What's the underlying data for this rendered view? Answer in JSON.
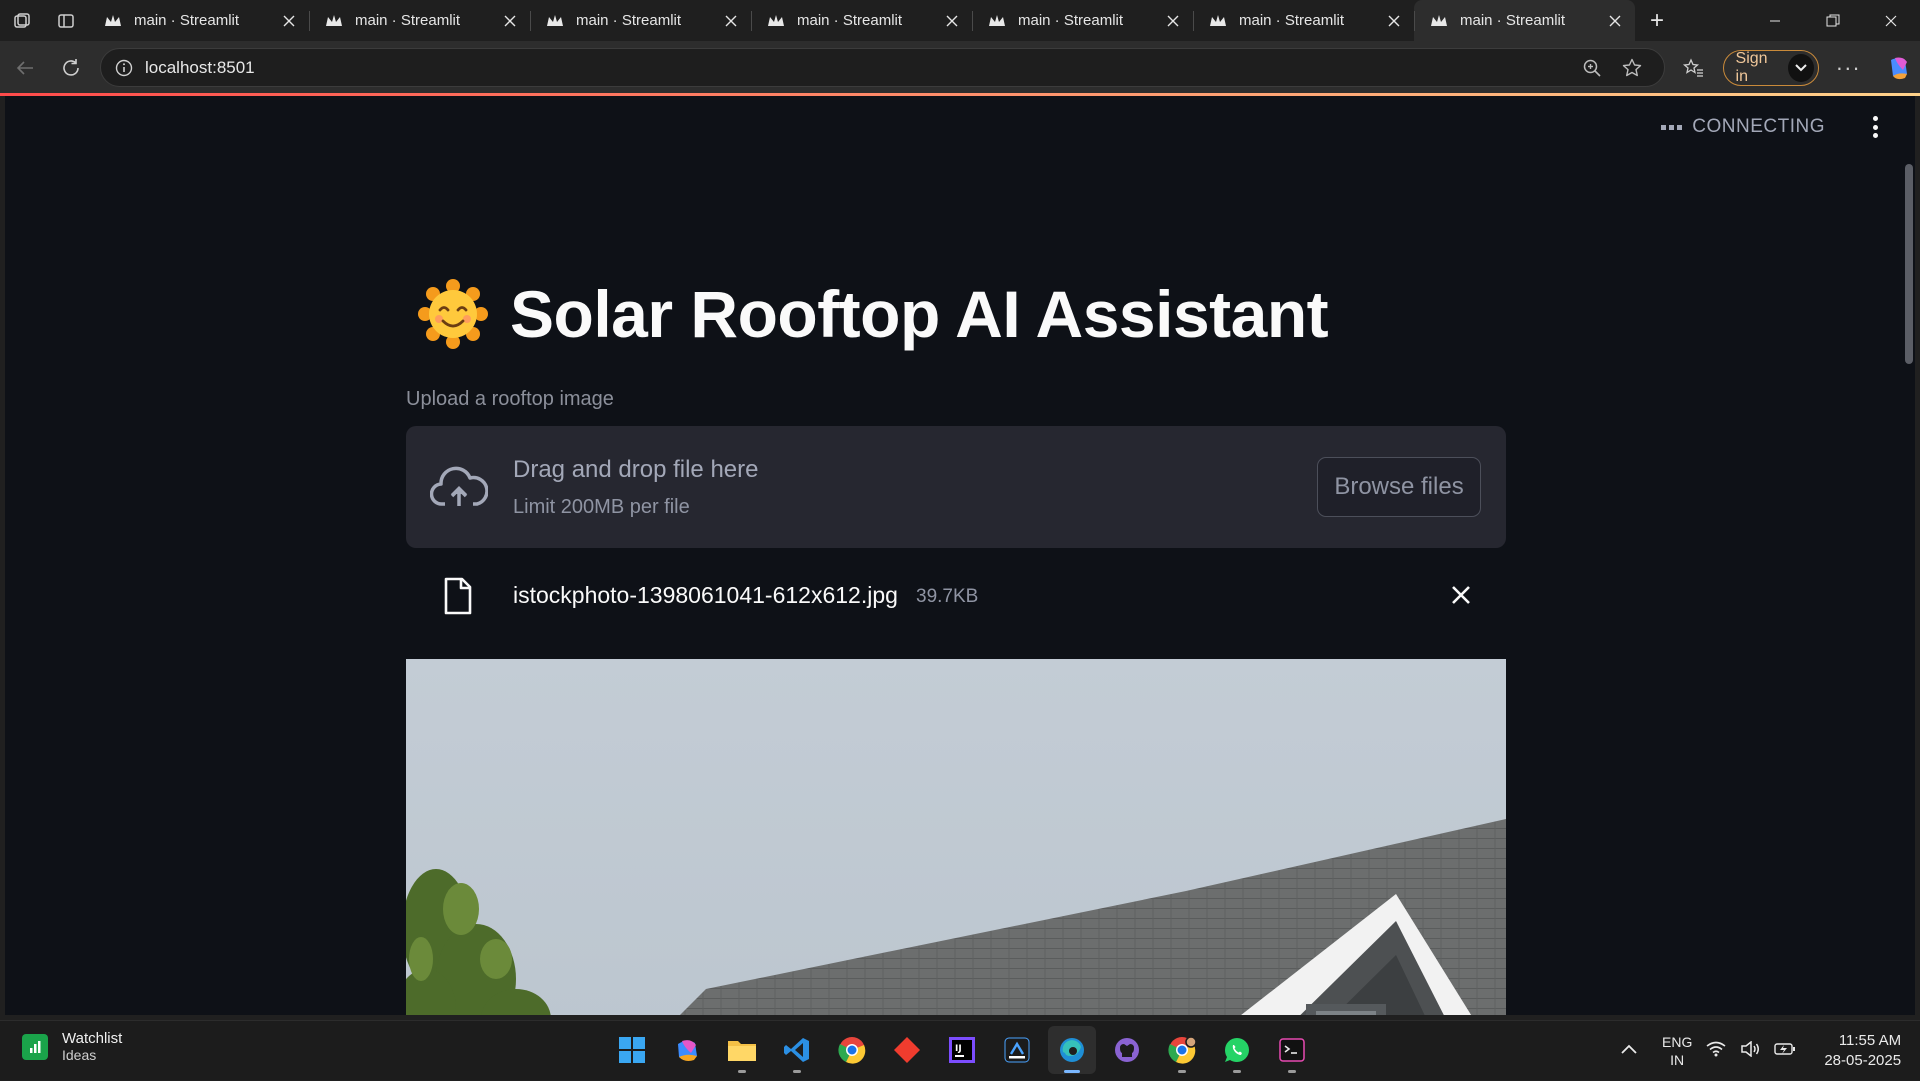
{
  "browser": {
    "tabs": [
      {
        "title": "main · Streamlit"
      },
      {
        "title": "main · Streamlit"
      },
      {
        "title": "main · Streamlit"
      },
      {
        "title": "main · Streamlit"
      },
      {
        "title": "main · Streamlit"
      },
      {
        "title": "main · Streamlit"
      },
      {
        "title": "main · Streamlit",
        "active": true
      }
    ],
    "url": "localhost:8501",
    "signin_label": "Sign in",
    "accent_color": "#ff4b4b"
  },
  "app": {
    "status": "CONNECTING",
    "title_emoji": "sun-with-face",
    "title": "Solar Rooftop AI Assistant",
    "uploader": {
      "label": "Upload a rooftop image",
      "drag_text": "Drag and drop file here",
      "limit_text": "Limit 200MB per file",
      "browse_label": "Browse files"
    },
    "file": {
      "name": "istockphoto-1398061041-612x612.jpg",
      "size": "39.7KB"
    }
  },
  "taskbar": {
    "widget_title": "Watchlist",
    "widget_subtitle": "Ideas",
    "apps": [
      "windows-start",
      "copilot",
      "file-explorer",
      "vscode",
      "chrome",
      "git-app",
      "intellij",
      "dev-app",
      "edge",
      "github-desktop",
      "chrome-profile",
      "whatsapp",
      "terminal"
    ],
    "lang_line1": "ENG",
    "lang_line2": "IN",
    "time": "11:55 AM",
    "date": "28-05-2025"
  }
}
